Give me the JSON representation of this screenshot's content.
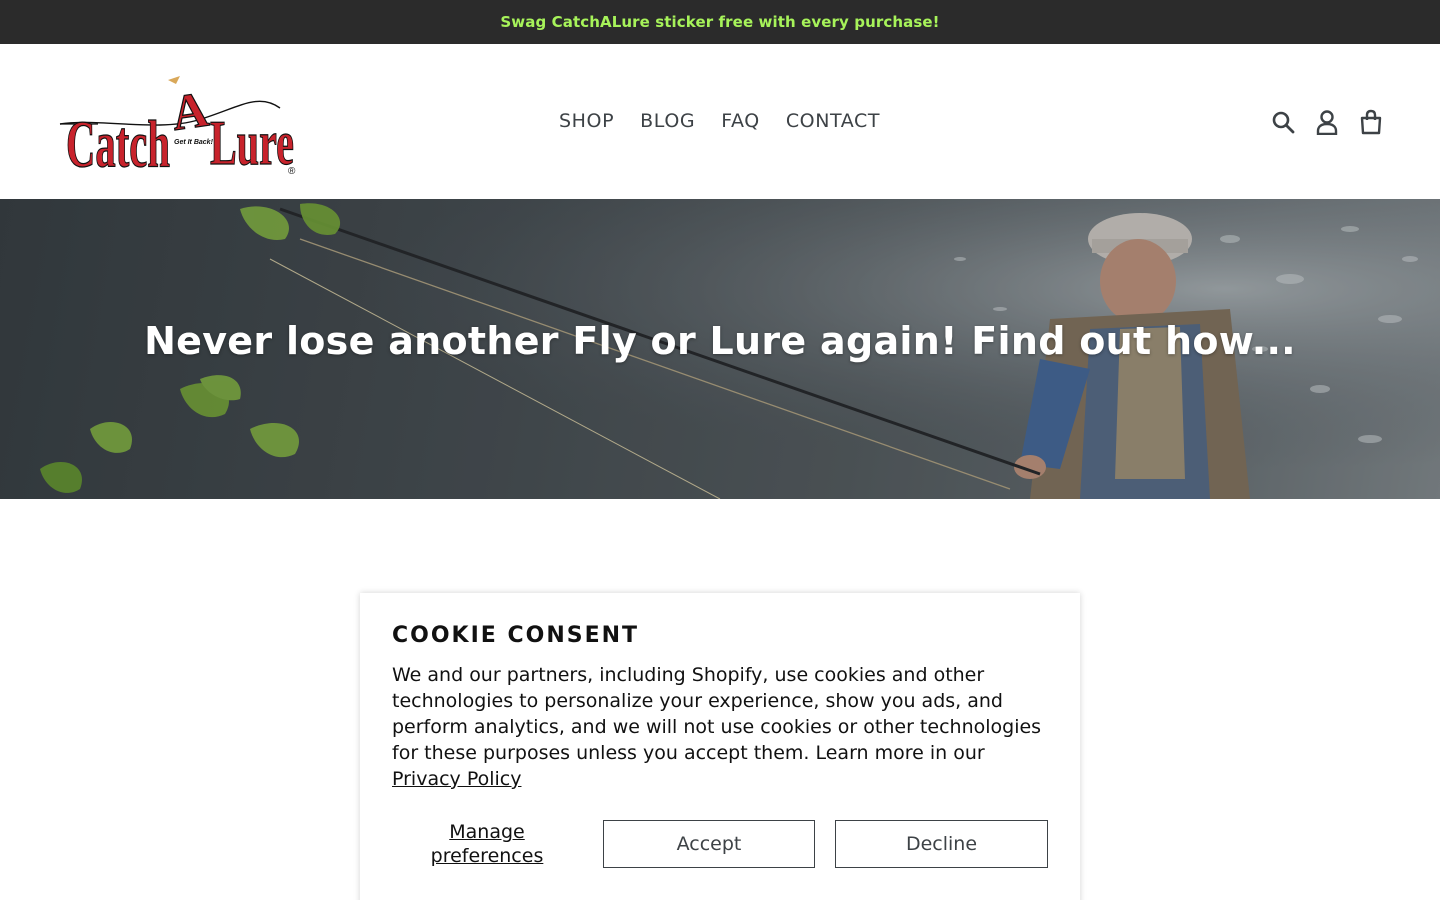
{
  "announcement": {
    "text": "Swag CatchALure sticker free with every purchase!"
  },
  "header": {
    "logo": {
      "brand": "CatchALure",
      "tagline": "Get It Back!",
      "parts": [
        "Catch",
        "A",
        "Lure"
      ],
      "registered": "®"
    },
    "nav": [
      {
        "label": "SHOP"
      },
      {
        "label": "BLOG"
      },
      {
        "label": "FAQ"
      },
      {
        "label": "CONTACT"
      }
    ],
    "icons": [
      "search-icon",
      "account-icon",
      "cart-icon"
    ]
  },
  "hero": {
    "title": "Never lose another Fly or Lure again! Find out how..."
  },
  "cookie": {
    "title": "COOKIE CONSENT",
    "body": "We and our partners, including Shopify, use cookies and other technologies to personalize your experience, show you ads, and perform analytics, and we will not use cookies or other technologies for these purposes unless you accept them. Learn more in our ",
    "link": "Privacy Policy",
    "manage": "Manage preferences",
    "accept": "Accept",
    "decline": "Decline"
  },
  "colors": {
    "announcement_bg": "#2b2b2b",
    "announcement_text": "#a7f35a",
    "logo_red": "#c8232c",
    "text": "#3d4246"
  }
}
